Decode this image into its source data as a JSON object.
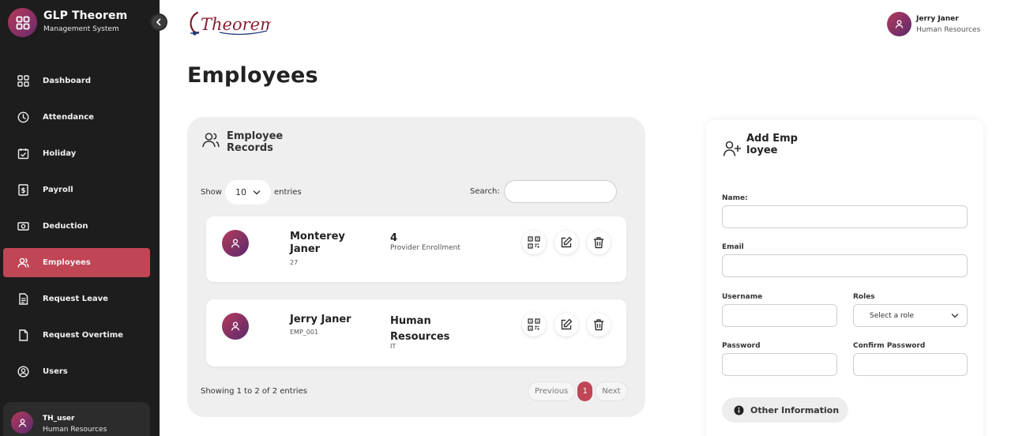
{
  "app": {
    "title": "GLP Theorem",
    "subtitle": "Management System",
    "logo_text": "Theorem"
  },
  "sidebar": {
    "items": [
      {
        "label": "Dashboard",
        "icon": "dashboard-icon"
      },
      {
        "label": "Attendance",
        "icon": "clock-icon"
      },
      {
        "label": "Holiday",
        "icon": "calendar-check-icon"
      },
      {
        "label": "Payroll",
        "icon": "payroll-icon"
      },
      {
        "label": "Deduction",
        "icon": "money-icon"
      },
      {
        "label": "Employees",
        "icon": "users-icon",
        "active": true
      },
      {
        "label": "Request Leave",
        "icon": "document-icon"
      },
      {
        "label": "Request Overtime",
        "icon": "file-icon"
      },
      {
        "label": "Users",
        "icon": "user-circle-icon"
      }
    ],
    "user": {
      "name": "TH_user",
      "role": "Human Resources"
    }
  },
  "topbar": {
    "user": {
      "name": "Jerry Janer",
      "role": "Human Resources"
    }
  },
  "page": {
    "title": "Employees"
  },
  "records": {
    "title": "Employee Records",
    "show_label": "Show",
    "entries_value": "10",
    "entries_label": "entries",
    "search_label": "Search:",
    "search_value": "",
    "rows": [
      {
        "name": "Monterey Janer",
        "id": "27",
        "dept": "4",
        "dept_sub": "Provider Enrollment"
      },
      {
        "name": "Jerry Janer",
        "id": "EMP_001",
        "dept": "Human Resources",
        "dept_sub": "IT"
      }
    ],
    "showing": "Showing 1 to 2 of 2 entries",
    "pagination": {
      "previous": "Previous",
      "current": "1",
      "next": "Next"
    }
  },
  "add_employee": {
    "title": "Add Employee",
    "fields": {
      "name": {
        "label": "Name:",
        "value": ""
      },
      "email": {
        "label": "Email",
        "value": ""
      },
      "username": {
        "label": "Username",
        "value": ""
      },
      "roles": {
        "label": "Roles",
        "value": "Select a role"
      },
      "password": {
        "label": "Password",
        "value": ""
      },
      "confirm_password": {
        "label": "Confirm Password",
        "value": ""
      }
    },
    "other_info": "Other Information"
  },
  "colors": {
    "accent": "#c04555",
    "sidebar_bg": "#1d1d1d",
    "panel_bg": "#efefef"
  }
}
